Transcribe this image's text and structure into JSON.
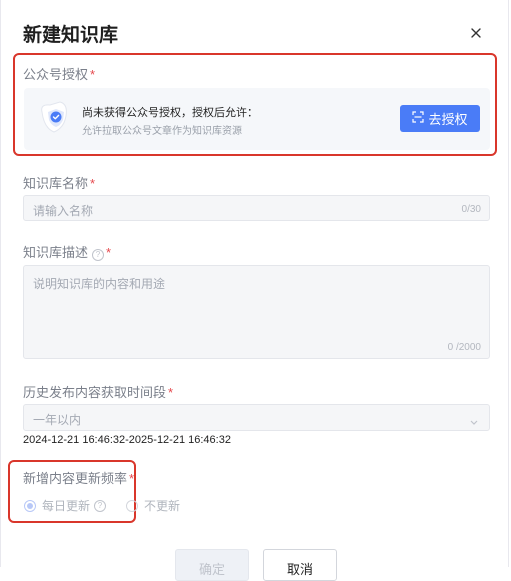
{
  "dialog": {
    "title": "新建知识库",
    "close_icon": "close-icon"
  },
  "auth": {
    "label": "公众号授权",
    "required_mark": "*",
    "title": "尚未获得公众号授权，授权后允许：",
    "subtitle": "允许拉取公众号文章作为知识库资源",
    "button_label": "去授权",
    "button_icon": "scan-icon",
    "illustration_icon": "shield-icon"
  },
  "name_field": {
    "label": "知识库名称",
    "required_mark": "*",
    "placeholder": "请输入名称",
    "count": "0/30"
  },
  "desc_field": {
    "label": "知识库描述",
    "help": "?",
    "required_mark": "*",
    "placeholder": "说明知识库的内容和用途",
    "count": "0 /2000"
  },
  "period_field": {
    "label": "历史发布内容获取时间段",
    "required_mark": "*",
    "selected": "一年以内",
    "date_range": "2024-12-21 16:46:32-2025-12-21 16:46:32"
  },
  "frequency_field": {
    "label": "新增内容更新频率",
    "required_mark": "*",
    "options": [
      {
        "label": "每日更新",
        "selected": true,
        "help": "?"
      },
      {
        "label": "不更新",
        "selected": false
      }
    ]
  },
  "footer": {
    "confirm_label": "确定",
    "cancel_label": "取消"
  },
  "colors": {
    "primary": "#4a7cf7",
    "highlight_border": "#d9362b",
    "required": "#e5484d"
  }
}
